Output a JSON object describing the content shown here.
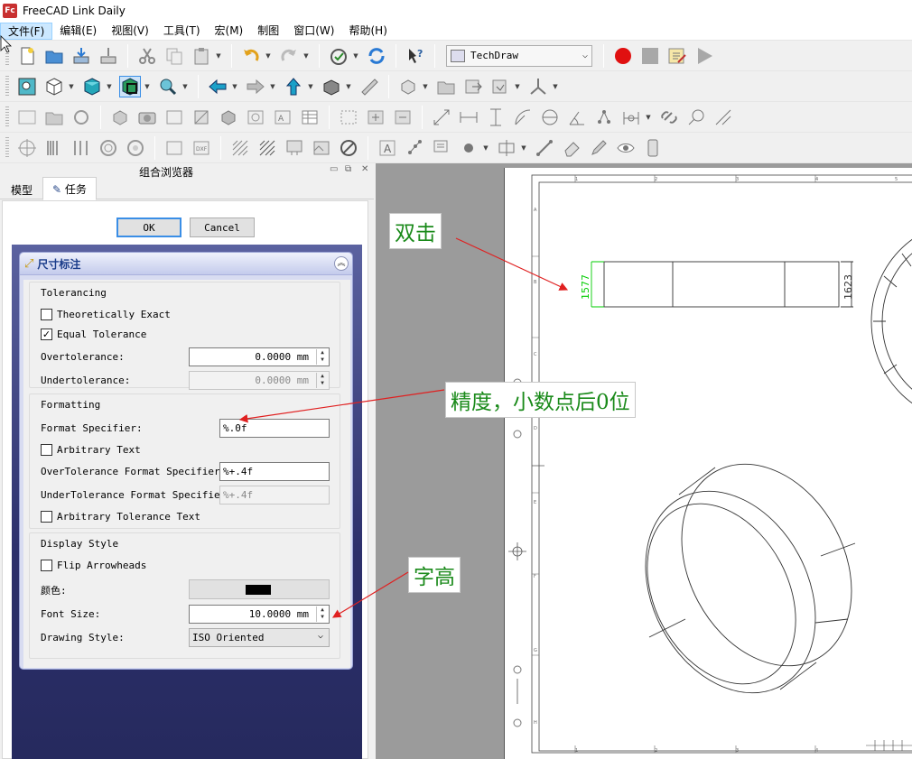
{
  "window": {
    "title": "FreeCAD Link Daily",
    "logo": "freecad-logo-icon"
  },
  "menubar": [
    "文件(F)",
    "编辑(E)",
    "视图(V)",
    "工具(T)",
    "宏(M)",
    "制图",
    "窗口(W)",
    "帮助(H)"
  ],
  "toolbar": {
    "workbench": "TechDraw"
  },
  "panel": {
    "title": "组合浏览器",
    "tabs": {
      "model": "模型",
      "tasks": "任务"
    },
    "ok_label": "OK",
    "cancel_label": "Cancel",
    "box_title": "尺寸标注",
    "tolerancing": {
      "title": "Tolerancing",
      "theoretically_exact": "Theoretically Exact",
      "equal_tolerance": "Equal Tolerance",
      "overtolerance_label": "Overtolerance:",
      "overtolerance_value": "0.0000 mm",
      "undertolerance_label": "Undertolerance:",
      "undertolerance_value": "0.0000 mm"
    },
    "formatting": {
      "title": "Formatting",
      "format_specifier_label": "Format Specifier:",
      "format_specifier_value": "%.0f",
      "arbitrary_text": "Arbitrary Text",
      "over_format_label": "OverTolerance Format Specifier:",
      "over_format_value": "%+.4f",
      "under_format_label": "UnderTolerance Format Specifier:",
      "under_format_value": "%+.4f",
      "arbitrary_tolerance_text": "Arbitrary Tolerance Text"
    },
    "display": {
      "title": "Display Style",
      "flip_arrowheads": "Flip Arrowheads",
      "color_label": "颜色:",
      "color_value": "#000000",
      "font_size_label": "Font Size:",
      "font_size_value": "10.0000 mm",
      "drawing_style_label": "Drawing Style:",
      "drawing_style_value": "ISO Oriented"
    }
  },
  "drawing": {
    "dimension_vertical": "1577",
    "dimension_right": "1623",
    "column_numbers": [
      "1",
      "2",
      "3",
      "4",
      "5"
    ],
    "row_letters": [
      "A",
      "B",
      "C",
      "D",
      "E",
      "F",
      "G",
      "H"
    ]
  },
  "annotations": {
    "double_click": "双击",
    "precision": "精度，小数点后0位",
    "font_height": "字高"
  },
  "colors": {
    "annotation_text": "#1a8a1a",
    "arrow": "#e02020",
    "dimension_green": "#00cc00"
  }
}
